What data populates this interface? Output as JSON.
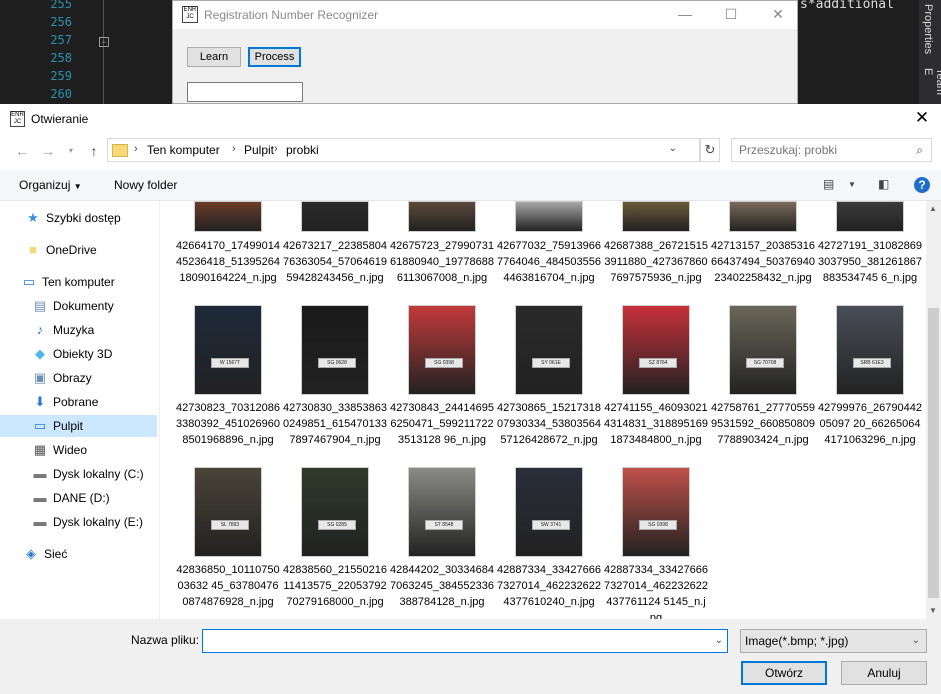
{
  "ide": {
    "line_numbers": [
      "255",
      "256",
      "257",
      "258",
      "259",
      "260"
    ],
    "code_tail": "s*additional",
    "side_tabs": [
      "Properties",
      "Team E"
    ]
  },
  "app_window": {
    "title": "Registration Number Recognizer",
    "learn_button": "Learn",
    "process_button": "Process",
    "minimize_glyph": "—",
    "maximize_glyph": "☐",
    "close_glyph": "✕",
    "icon_text": "ENR JC"
  },
  "dialog": {
    "title": "Otwieranie",
    "close_glyph": "✕",
    "icon_text": "ENR JC",
    "breadcrumb": [
      "Ten komputer",
      "Pulpit",
      "probki"
    ],
    "search_placeholder": "Przeszukaj: probki",
    "toolbar": {
      "organize": "Organizuj",
      "new_folder": "Nowy folder"
    },
    "nav_items": [
      {
        "label": "Szybki dostęp",
        "icon": "star-icon",
        "glyph": "★",
        "color": "#3a8ee6"
      },
      {
        "label": "OneDrive",
        "icon": "folder-icon",
        "glyph": "■",
        "color": "#f8d775"
      },
      {
        "label": "Ten komputer",
        "icon": "computer-icon",
        "glyph": "▭",
        "color": "#2b79d1"
      },
      {
        "label": "Dokumenty",
        "icon": "documents-icon",
        "glyph": "▤",
        "color": "#6b8fb5"
      },
      {
        "label": "Muzyka",
        "icon": "music-icon",
        "glyph": "♪",
        "color": "#2b79d1"
      },
      {
        "label": "Obiekty 3D",
        "icon": "cube-icon",
        "glyph": "◆",
        "color": "#4fb7e8"
      },
      {
        "label": "Obrazy",
        "icon": "pictures-icon",
        "glyph": "▣",
        "color": "#6b8fb5"
      },
      {
        "label": "Pobrane",
        "icon": "download-icon",
        "glyph": "⬇",
        "color": "#2b79d1"
      },
      {
        "label": "Pulpit",
        "icon": "desktop-icon",
        "glyph": "▭",
        "color": "#2b79d1"
      },
      {
        "label": "Wideo",
        "icon": "video-icon",
        "glyph": "▦",
        "color": "#555555"
      },
      {
        "label": "Dysk lokalny (C:)",
        "icon": "drive-icon",
        "glyph": "▬",
        "color": "#777777"
      },
      {
        "label": "DANE (D:)",
        "icon": "drive-icon",
        "glyph": "▬",
        "color": "#777777"
      },
      {
        "label": "Dysk lokalny (E:)",
        "icon": "drive-icon",
        "glyph": "▬",
        "color": "#777777"
      },
      {
        "label": "Sieć",
        "icon": "network-icon",
        "glyph": "◈",
        "color": "#2b79d1"
      }
    ],
    "selected_nav": "Pulpit",
    "files": [
      {
        "name": "42664170_1749901445236418_5139526418090164224_n.jpg",
        "bg": "#6b3b2a",
        "plate": ""
      },
      {
        "name": "42673217_2238580476363054_5706461959428243456_n.jpg",
        "bg": "#2a2a2a",
        "plate": ""
      },
      {
        "name": "42675723_2799073161880940_197786886113067008_n.jpg",
        "bg": "#5a4a3a",
        "plate": ""
      },
      {
        "name": "42677032_759139667764046_4845035564463816704_n.jpg",
        "bg": "#a8a8a8",
        "plate": ""
      },
      {
        "name": "42687388_267215153911880_4273678607697575936_n.jpg",
        "bg": "#6a5a3a",
        "plate": ""
      },
      {
        "name": "42713157_2038531666437494_5037694023402258432_n.jpg",
        "bg": "#7a6a5a",
        "plate": ""
      },
      {
        "name": "42727191_310828693037950_381261867883534745 6_n.jpg",
        "bg": "#3a3a3a",
        "plate": ""
      },
      {
        "name": "42730823_703120863380392_4510269608501968896_n.jpg",
        "bg": "#1e2a3a",
        "plate": "W 1567T"
      },
      {
        "name": "42730830_338538630249851_6154701337897467904_n.jpg",
        "bg": "#1a1a1a",
        "plate": "SG 0628"
      },
      {
        "name": "42730843_244146956250471_5992117223513128 96_n.jpg",
        "bg": "#c23a3a",
        "plate": "SG 0398"
      },
      {
        "name": "42730865_1521731807930334_5380356457126428672_n.jpg",
        "bg": "#2a2a2a",
        "plate": "SY 061E"
      },
      {
        "name": "42741155_460930214314831_3188951691873484800_n.jpg",
        "bg": "#c8303a",
        "plate": "SZ 8764"
      },
      {
        "name": "42758761_277705599531592_6608508097788903424_n.jpg",
        "bg": "#6a6658",
        "plate": "SG 70708"
      },
      {
        "name": "42799976_2679044205097 20_662650644171063296_n.jpg",
        "bg": "#4a4e58",
        "plate": "SRB 61E3"
      },
      {
        "name": "42836850_1011075003632 45_637804760874876928_n.jpg",
        "bg": "#4a4438",
        "plate": "SL 7893"
      },
      {
        "name": "42838560_2155021611413575_2205379270279168000_n.jpg",
        "bg": "#2e3a2a",
        "plate": "SG 0285"
      },
      {
        "name": "42844202_303346847063245_384552336388784128_n.jpg",
        "bg": "#8a8a86",
        "plate": "ST 8548"
      },
      {
        "name": "42887334_334276667327014_4622326224377610240_n.jpg",
        "bg": "#2a2e3a",
        "plate": "SW 3741"
      },
      {
        "name": "42887334_334276667327014_462232622437761124 5145_n.jpg",
        "bg": "#c0504a",
        "plate": "SG 0398"
      }
    ],
    "filename_label": "Nazwa pliku:",
    "filename_value": "",
    "filetype": "Image(*.bmp; *.jpg)",
    "open_button": "Otwórz",
    "cancel_button": "Anuluj"
  }
}
